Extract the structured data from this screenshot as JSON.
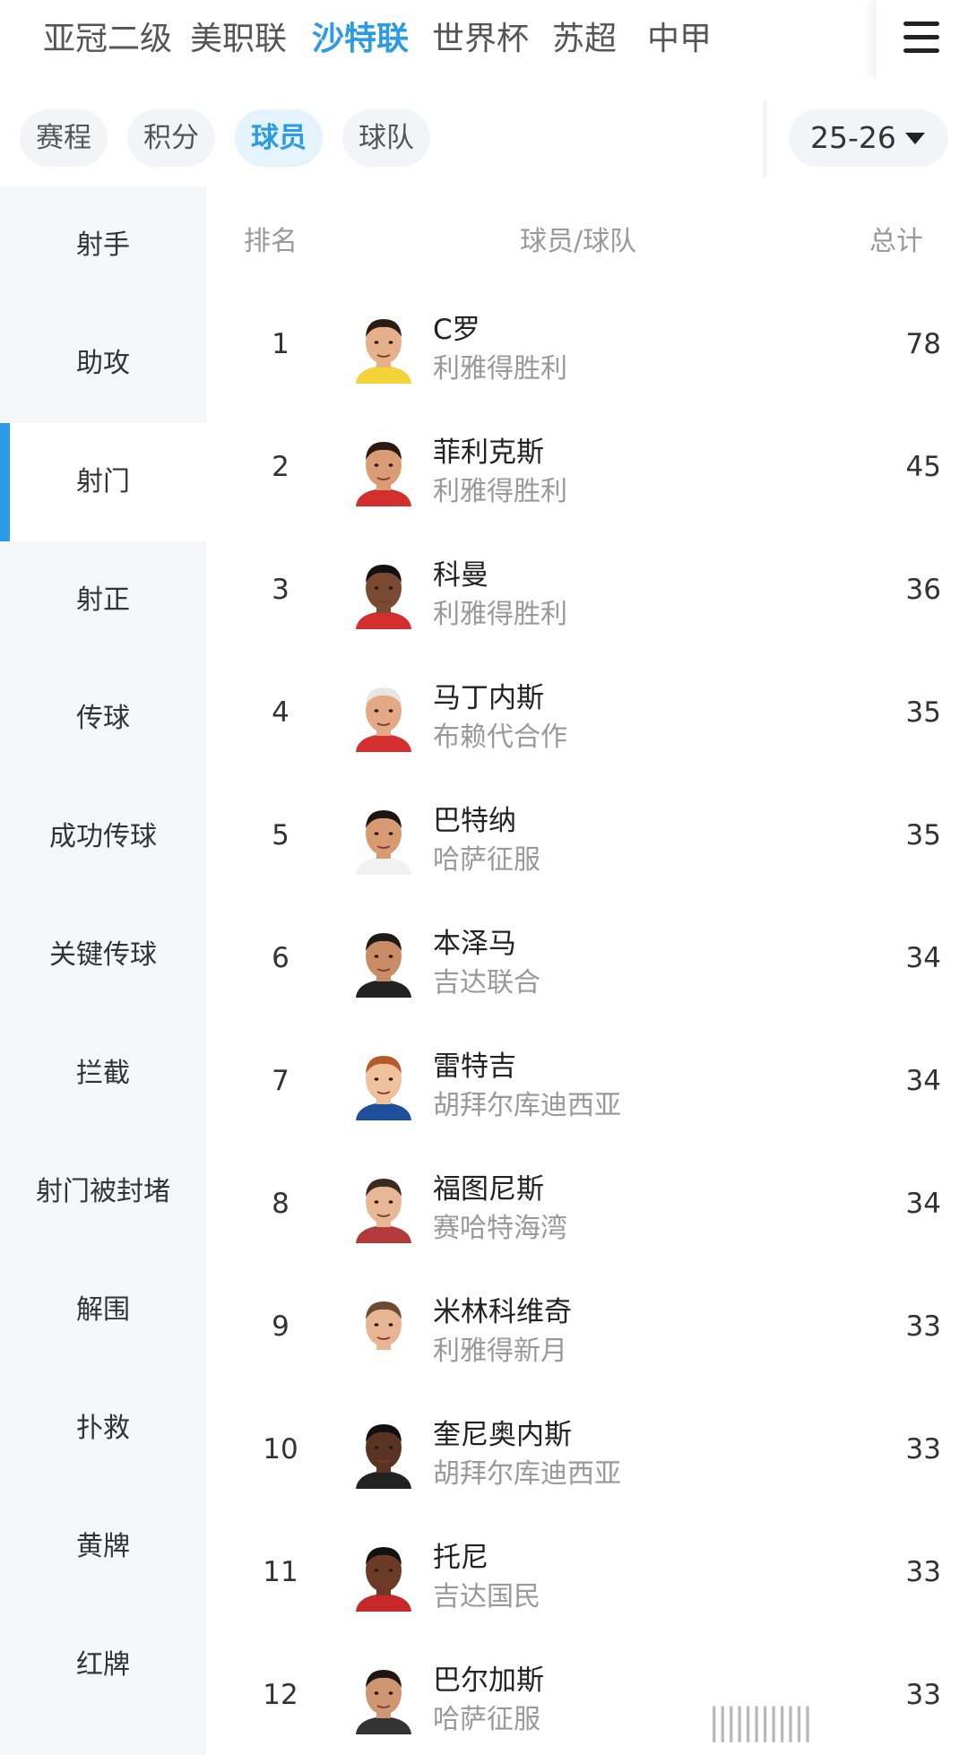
{
  "league_tabs": [
    "亚冠二级",
    "美职联",
    "沙特联",
    "世界杯",
    "苏超",
    "中甲"
  ],
  "league_active": "沙特联",
  "categories": [
    "赛程",
    "积分",
    "球员",
    "球队"
  ],
  "category_active": "球员",
  "season": "25-26",
  "sidebar": [
    "射手",
    "助攻",
    "射门",
    "射正",
    "传球",
    "成功传球",
    "关键传球",
    "拦截",
    "射门被封堵",
    "解围",
    "扑救",
    "黄牌",
    "红牌"
  ],
  "sidebar_active": "射门",
  "table": {
    "headers": {
      "rank": "排名",
      "player_team": "球员/球队",
      "total": "总计"
    },
    "rows": [
      {
        "rank": "1",
        "player": "C罗",
        "team": "利雅得胜利",
        "total": "78"
      },
      {
        "rank": "2",
        "player": "菲利克斯",
        "team": "利雅得胜利",
        "total": "45"
      },
      {
        "rank": "3",
        "player": "科曼",
        "team": "利雅得胜利",
        "total": "36"
      },
      {
        "rank": "4",
        "player": "马丁内斯",
        "team": "布赖代合作",
        "total": "35"
      },
      {
        "rank": "5",
        "player": "巴特纳",
        "team": "哈萨征服",
        "total": "35"
      },
      {
        "rank": "6",
        "player": "本泽马",
        "team": "吉达联合",
        "total": "34"
      },
      {
        "rank": "7",
        "player": "雷特吉",
        "team": "胡拜尔库迪西亚",
        "total": "34"
      },
      {
        "rank": "8",
        "player": "福图尼斯",
        "team": "赛哈特海湾",
        "total": "34"
      },
      {
        "rank": "9",
        "player": "米林科维奇",
        "team": "利雅得新月",
        "total": "33"
      },
      {
        "rank": "10",
        "player": "奎尼奥内斯",
        "team": "胡拜尔库迪西亚",
        "total": "33"
      },
      {
        "rank": "11",
        "player": "托尼",
        "team": "吉达国民",
        "total": "33"
      },
      {
        "rank": "12",
        "player": "巴尔加斯",
        "team": "哈萨征服",
        "total": "33"
      }
    ]
  },
  "icons": {
    "menu": "menu-icon",
    "season_caret": "chevron-down-icon",
    "avatar": "player-avatar"
  },
  "colors": {
    "accent": "#2b9be6",
    "sidebar_bg": "#f5f6f8",
    "muted_text": "#999999"
  }
}
